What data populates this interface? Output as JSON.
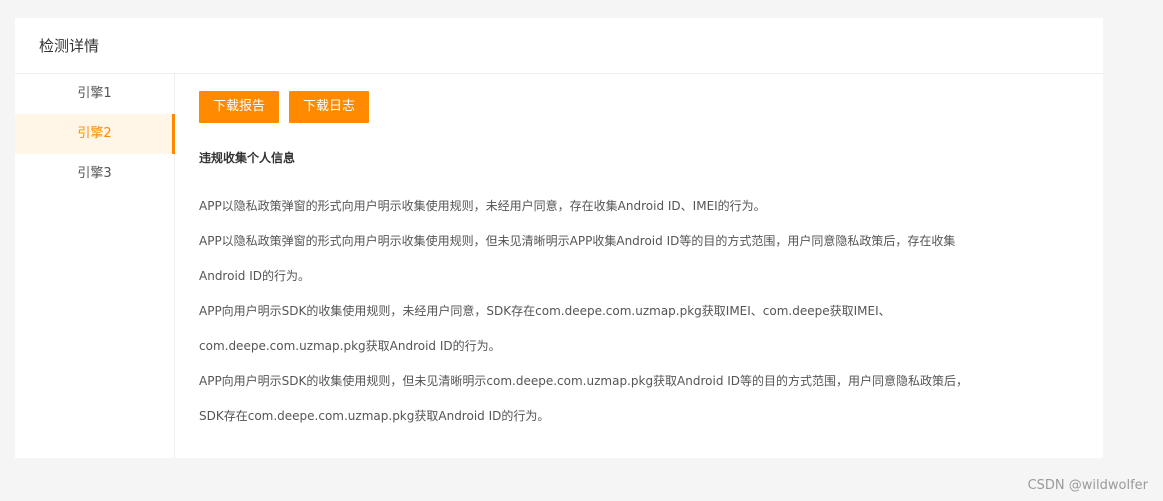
{
  "card": {
    "title": "检测详情"
  },
  "sidebar": {
    "items": [
      {
        "label": "引擎1"
      },
      {
        "label": "引擎2"
      },
      {
        "label": "引擎3"
      }
    ]
  },
  "toolbar": {
    "download_report_label": "下载报告",
    "download_log_label": "下载日志"
  },
  "section": {
    "title": "违规收集个人信息",
    "lines": [
      "APP以隐私政策弹窗的形式向用户明示收集使用规则，未经用户同意，存在收集Android ID、IMEI的行为。",
      "APP以隐私政策弹窗的形式向用户明示收集使用规则，但未见清晰明示APP收集Android ID等的目的方式范围，用户同意隐私政策后，存在收集",
      "Android ID的行为。",
      "APP向用户明示SDK的收集使用规则，未经用户同意，SDK存在com.deepe.com.uzmap.pkg获取IMEI、com.deepe获取IMEI、",
      "com.deepe.com.uzmap.pkg获取Android ID的行为。",
      "APP向用户明示SDK的收集使用规则，但未见清晰明示com.deepe.com.uzmap.pkg获取Android ID等的目的方式范围，用户同意隐私政策后，",
      "SDK存在com.deepe.com.uzmap.pkg获取Android ID的行为。"
    ]
  },
  "watermark": "CSDN @wildwolfer",
  "colors": {
    "accent": "#ff8a00",
    "active_bg": "#fff6e8",
    "page_bg": "#f5f5f5"
  }
}
